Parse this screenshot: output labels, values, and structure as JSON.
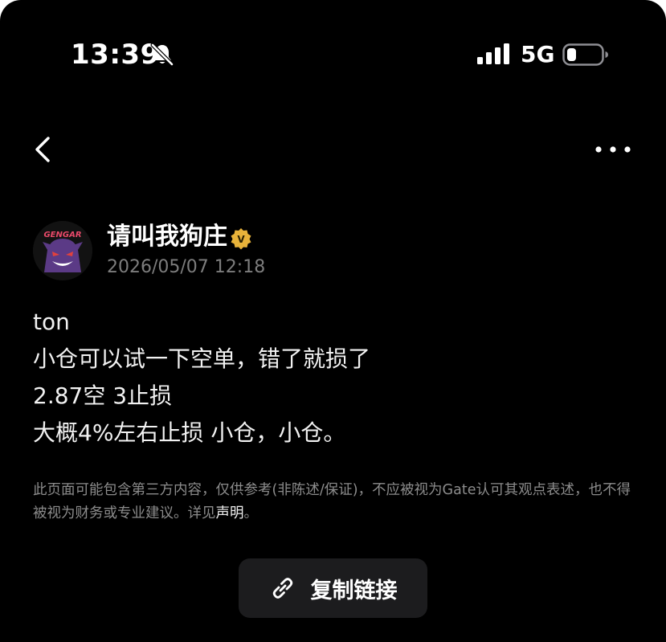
{
  "status_bar": {
    "time": "13:39",
    "network": "5G",
    "icons": [
      "bell-muted-icon",
      "signal-icon",
      "battery-icon"
    ]
  },
  "nav": {
    "back_icon": "chevron-left-icon",
    "more_icon": "more-horizontal-icon"
  },
  "author": {
    "name": "请叫我狗庄",
    "timestamp": "2026/05/07 12:18",
    "avatar_text": "GENGAR",
    "verified_badge": "V"
  },
  "post": {
    "lines": [
      "ton",
      "小仓可以试一下空单，错了就损了",
      "2.87空 3止损",
      "大概4%左右止损 小仓，小仓。"
    ]
  },
  "disclaimer": {
    "text": "此页面可能包含第三方内容，仅供参考(非陈述/保证)，不应被视为Gate认可其观点表述，也不得被视为财务或专业建议。详见",
    "link_label": "声明",
    "suffix": "。"
  },
  "actions": {
    "copy_link_label": "复制链接"
  },
  "colors": {
    "background": "#000000",
    "text": "#ffffff",
    "muted": "#7d7d7d",
    "button_bg": "#1c1c1e",
    "verified": "#e8b33a"
  }
}
